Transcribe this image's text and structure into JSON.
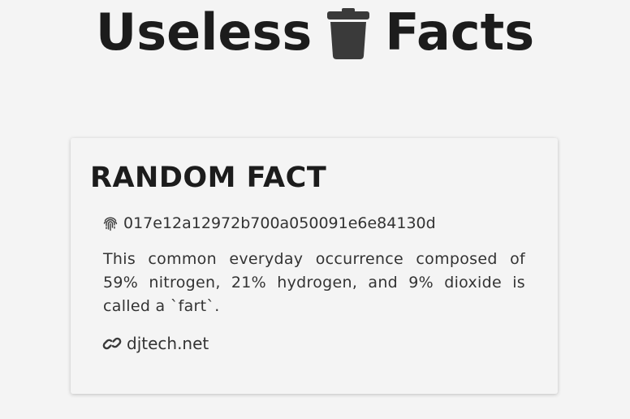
{
  "header": {
    "title_left": "Useless",
    "title_icon": "trash-icon",
    "title_right": "Facts"
  },
  "card": {
    "heading": "RANDOM FACT",
    "id_icon": "fingerprint-icon",
    "fact_id": "017e12a12972b700a050091e6e84130d",
    "text": "This common everyday occurrence composed of 59% nitrogen, 21% hydrogen, and 9% dioxide is called a `fart`.",
    "source_icon": "link-icon",
    "source": "djtech.net"
  },
  "colors": {
    "background": "#f4f4f4",
    "title": "#1c1c1c",
    "icon": "#3a3a3a",
    "body_text": "#333333"
  }
}
